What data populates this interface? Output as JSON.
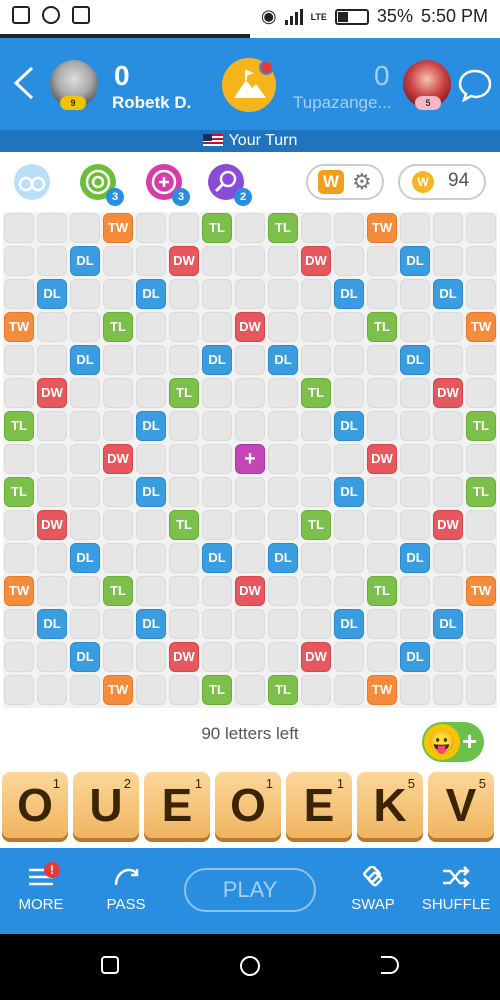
{
  "status_bar": {
    "network": "LTE",
    "battery_percent": "35%",
    "battery_level": 0.35,
    "time": "5:50 PM",
    "icons": [
      "screenshot-icon",
      "sync-icon",
      "battery-saver-icon",
      "wifi-hotspot-icon",
      "signal-icon",
      "battery-icon"
    ]
  },
  "header": {
    "back_icon": "chevron-left-icon",
    "player": {
      "score": "0",
      "name": "Robetk D.",
      "level": "9"
    },
    "opponent": {
      "score": "0",
      "name": "Tupazange...",
      "level": "5"
    },
    "center_icon": "mountain-flag-icon",
    "chat_icon": "chat-bubble-icon"
  },
  "turn": {
    "text": "Your Turn"
  },
  "powerups": [
    {
      "icon": "glasses-icon",
      "count": "",
      "color": "#b9dff6"
    },
    {
      "icon": "target-icon",
      "count": "3",
      "color": "#6bbd3a"
    },
    {
      "icon": "swap-plus-icon",
      "count": "3",
      "color": "#d63da8"
    },
    {
      "icon": "magnifier-icon",
      "count": "2",
      "color": "#8a4bd6"
    }
  ],
  "word_button": {
    "letter": "W"
  },
  "coins": {
    "count": "94"
  },
  "board": {
    "size": 15,
    "premiums": [
      [
        ".",
        ".",
        ".",
        "TW",
        ".",
        ".",
        "TL",
        ".",
        "TL",
        ".",
        ".",
        "TW",
        ".",
        ".",
        "."
      ],
      [
        ".",
        ".",
        "DL",
        ".",
        ".",
        "DW",
        ".",
        ".",
        ".",
        "DW",
        ".",
        ".",
        "DL",
        ".",
        "."
      ],
      [
        ".",
        "DL",
        ".",
        ".",
        "DL",
        ".",
        ".",
        ".",
        ".",
        ".",
        "DL",
        ".",
        ".",
        "DL",
        "."
      ],
      [
        "TW",
        ".",
        ".",
        "TL",
        ".",
        ".",
        ".",
        "DW",
        ".",
        ".",
        ".",
        "TL",
        ".",
        ".",
        "TW"
      ],
      [
        ".",
        ".",
        "DL",
        ".",
        ".",
        ".",
        "DL",
        ".",
        "DL",
        ".",
        ".",
        ".",
        "DL",
        ".",
        "."
      ],
      [
        ".",
        "DW",
        ".",
        ".",
        ".",
        "TL",
        ".",
        ".",
        ".",
        "TL",
        ".",
        ".",
        ".",
        "DW",
        "."
      ],
      [
        "TL",
        ".",
        ".",
        ".",
        "DL",
        ".",
        ".",
        ".",
        ".",
        ".",
        "DL",
        ".",
        ".",
        ".",
        "TL"
      ],
      [
        ".",
        ".",
        ".",
        "DW",
        ".",
        ".",
        ".",
        "STAR",
        ".",
        ".",
        ".",
        "DW",
        ".",
        ".",
        "."
      ],
      [
        "TL",
        ".",
        ".",
        ".",
        "DL",
        ".",
        ".",
        ".",
        ".",
        ".",
        "DL",
        ".",
        ".",
        ".",
        "TL"
      ],
      [
        ".",
        "DW",
        ".",
        ".",
        ".",
        "TL",
        ".",
        ".",
        ".",
        "TL",
        ".",
        ".",
        ".",
        "DW",
        "."
      ],
      [
        ".",
        ".",
        "DL",
        ".",
        ".",
        ".",
        "DL",
        ".",
        "DL",
        ".",
        ".",
        ".",
        "DL",
        ".",
        "."
      ],
      [
        "TW",
        ".",
        ".",
        "TL",
        ".",
        ".",
        ".",
        "DW",
        ".",
        ".",
        ".",
        "TL",
        ".",
        ".",
        "TW"
      ],
      [
        ".",
        "DL",
        ".",
        ".",
        "DL",
        ".",
        ".",
        ".",
        ".",
        ".",
        "DL",
        ".",
        ".",
        "DL",
        "."
      ],
      [
        ".",
        ".",
        "DL",
        ".",
        ".",
        "DW",
        ".",
        ".",
        ".",
        "DW",
        ".",
        ".",
        "DL",
        ".",
        "."
      ],
      [
        ".",
        ".",
        ".",
        "TW",
        ".",
        ".",
        "TL",
        ".",
        "TL",
        ".",
        ".",
        "TW",
        ".",
        ".",
        "."
      ]
    ],
    "star_symbol": "+",
    "colors": {
      "TW": "#f48c3c",
      "DW": "#e7585e",
      "TL": "#7cbf4a",
      "DL": "#3a9de0"
    }
  },
  "letters_left": "90 letters left",
  "emoji_button": {
    "face": "😛",
    "plus": "+"
  },
  "rack": [
    {
      "letter": "O",
      "points": "1"
    },
    {
      "letter": "U",
      "points": "2"
    },
    {
      "letter": "E",
      "points": "1"
    },
    {
      "letter": "O",
      "points": "1"
    },
    {
      "letter": "E",
      "points": "1"
    },
    {
      "letter": "K",
      "points": "5"
    },
    {
      "letter": "V",
      "points": "5"
    }
  ],
  "bottom_bar": {
    "more": {
      "label": "MORE",
      "badge": "!"
    },
    "pass": {
      "label": "PASS"
    },
    "play": {
      "label": "PLAY"
    },
    "swap": {
      "label": "SWAP"
    },
    "shuffle": {
      "label": "SHUFFLE"
    }
  }
}
